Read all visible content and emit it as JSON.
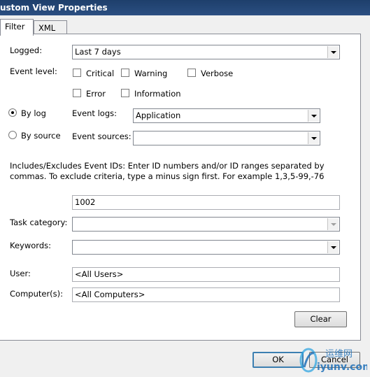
{
  "window": {
    "title": "ustom View Properties"
  },
  "tabs": [
    {
      "label": "Filter",
      "active": true
    },
    {
      "label": "XML",
      "active": false
    }
  ],
  "filter": {
    "logged_label": "Logged:",
    "logged_value": "Last 7 days",
    "event_level_label": "Event level:",
    "levels": {
      "critical": "Critical",
      "warning": "Warning",
      "verbose": "Verbose",
      "error": "Error",
      "information": "Information"
    },
    "by_log_label": "By log",
    "by_source_label": "By source",
    "event_logs_label": "Event logs:",
    "event_logs_value": "Application",
    "event_sources_label": "Event sources:",
    "event_sources_value": "",
    "ids_help": "Includes/Excludes Event IDs: Enter ID numbers and/or ID ranges separated by commas. To exclude criteria, type a minus sign first. For example 1,3,5-99,-76",
    "event_ids_value": "1002",
    "task_category_label": "Task category:",
    "task_category_value": "",
    "keywords_label": "Keywords:",
    "keywords_value": "",
    "user_label": "User:",
    "user_value": "<All Users>",
    "computers_label": "Computer(s):",
    "computers_value": "<All Computers>",
    "clear_label": "Clear"
  },
  "footer": {
    "ok_label": "OK",
    "cancel_label": "Cancel"
  },
  "watermark": {
    "line1": "运维网",
    "line2": "iyunv.com"
  }
}
